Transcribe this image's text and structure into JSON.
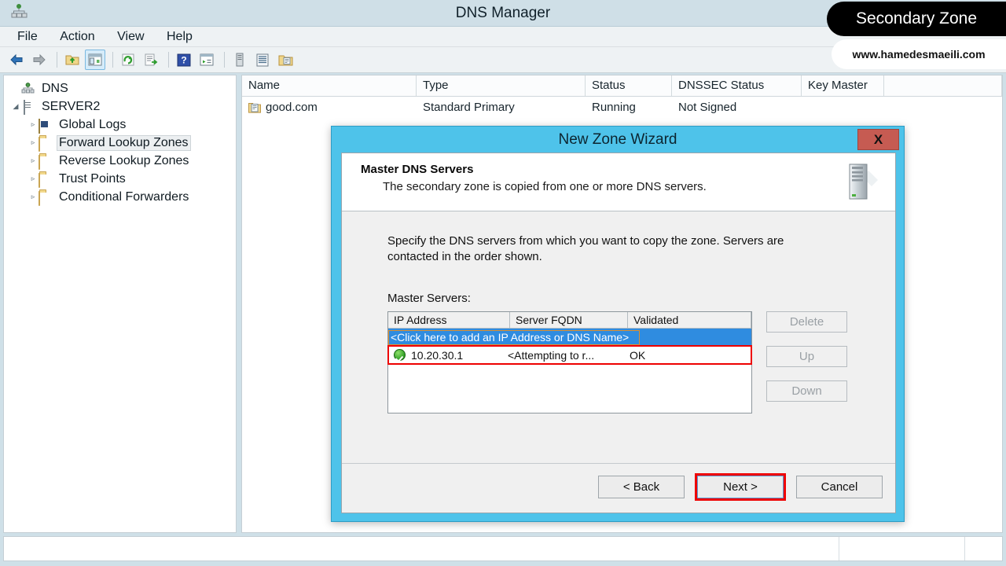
{
  "window": {
    "title": "DNS Manager",
    "app_icon": "dns-tree-icon"
  },
  "menubar": {
    "items": [
      {
        "label": "File"
      },
      {
        "label": "Action"
      },
      {
        "label": "View"
      },
      {
        "label": "Help"
      }
    ]
  },
  "toolbar": {
    "buttons": [
      {
        "name": "back-icon",
        "glyph": "←"
      },
      {
        "name": "forward-icon",
        "glyph": "→"
      },
      {
        "name": "up-folder-icon",
        "glyph": "▲"
      },
      {
        "name": "show-hide-tree-icon",
        "glyph": "▤"
      },
      {
        "name": "refresh-icon",
        "glyph": "↻"
      },
      {
        "name": "export-list-icon",
        "glyph": "≡"
      },
      {
        "name": "help-icon",
        "glyph": "?"
      },
      {
        "name": "properties-icon",
        "glyph": "▶"
      },
      {
        "name": "server-icon",
        "glyph": "▮"
      },
      {
        "name": "list-icon",
        "glyph": "≣"
      },
      {
        "name": "new-zone-icon",
        "glyph": "▣"
      }
    ]
  },
  "tree": {
    "nodes": [
      {
        "label": "DNS",
        "level": 0,
        "expander": "",
        "icon": "dns-root-icon",
        "selected": false
      },
      {
        "label": "SERVER2",
        "level": 1,
        "expander": "◢",
        "icon": "server-icon",
        "selected": false
      },
      {
        "label": "Global Logs",
        "level": 2,
        "expander": "▹",
        "icon": "global-logs-icon",
        "selected": false
      },
      {
        "label": "Forward Lookup Zones",
        "level": 2,
        "expander": "▹",
        "icon": "folder-icon",
        "selected": true
      },
      {
        "label": "Reverse Lookup Zones",
        "level": 2,
        "expander": "▹",
        "icon": "folder-icon",
        "selected": false
      },
      {
        "label": "Trust Points",
        "level": 2,
        "expander": "▹",
        "icon": "folder-icon",
        "selected": false
      },
      {
        "label": "Conditional Forwarders",
        "level": 2,
        "expander": "▹",
        "icon": "folder-icon",
        "selected": false
      }
    ]
  },
  "listview": {
    "columns": [
      "Name",
      "Type",
      "Status",
      "DNSSEC Status",
      "Key Master"
    ],
    "rows": [
      {
        "name": "good.com",
        "type": "Standard Primary",
        "status": "Running",
        "dnssec_status": "Not Signed",
        "key_master": ""
      }
    ]
  },
  "statusbar": {
    "text": ""
  },
  "dialog": {
    "title": "New Zone Wizard",
    "close_label": "X",
    "header": {
      "title": "Master DNS Servers",
      "subtitle": "The secondary zone is copied from one or more DNS servers.",
      "icon": "server-tower-icon"
    },
    "body": {
      "paragraph": "Specify the DNS servers from which you want to copy the zone.  Servers are contacted in the order shown.",
      "master_servers_label": "Master Servers:",
      "table": {
        "columns": [
          "IP Address",
          "Server FQDN",
          "Validated"
        ],
        "add_row_text": "<Click here to add an IP Address or DNS Name>",
        "rows": [
          {
            "status_icon": "validated-ok-icon",
            "ip_address": "10.20.30.1",
            "server_fqdn": "<Attempting to r...",
            "validated": "OK",
            "highlighted": true
          }
        ]
      },
      "side_buttons": [
        {
          "label": "Delete",
          "enabled": false
        },
        {
          "label": "Up",
          "enabled": false
        },
        {
          "label": "Down",
          "enabled": false
        }
      ]
    },
    "footer": {
      "buttons": [
        {
          "label": "< Back",
          "highlighted": false
        },
        {
          "label": "Next >",
          "highlighted": true
        },
        {
          "label": "Cancel",
          "highlighted": false
        }
      ]
    }
  },
  "watermarks": {
    "badge": "Secondary Zone",
    "site": "www.hamedesmaeili.com"
  },
  "colors": {
    "dialog_border": "#4ec3ea",
    "close_button": "#c65b52",
    "highlight_red": "#ee0000",
    "selection_blue": "#2f8ce0"
  }
}
